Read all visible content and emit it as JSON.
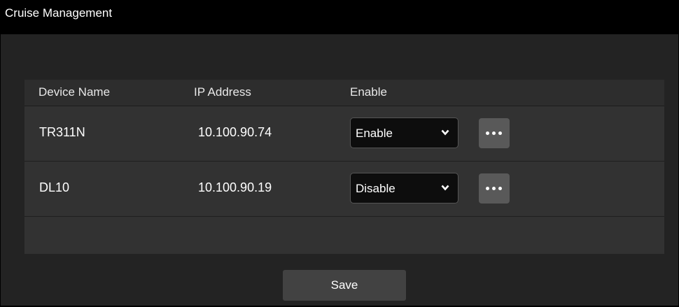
{
  "window": {
    "title": "Cruise Management"
  },
  "table": {
    "columns": [
      "Device Name",
      "IP Address",
      "Enable"
    ],
    "rows": [
      {
        "device_name": "TR311N",
        "ip_address": "10.100.90.74",
        "enable": "Enable"
      },
      {
        "device_name": "DL10",
        "ip_address": "10.100.90.19",
        "enable": "Disable"
      }
    ],
    "select_options": [
      "Enable",
      "Disable"
    ]
  },
  "actions": {
    "save_label": "Save"
  },
  "icons": {
    "row_more": "more-dots-icon",
    "dropdown": "chevron-down-icon"
  },
  "colors": {
    "titlebar": "#000000",
    "panel": "#323232",
    "button": "#424242",
    "more_button": "#595959"
  }
}
